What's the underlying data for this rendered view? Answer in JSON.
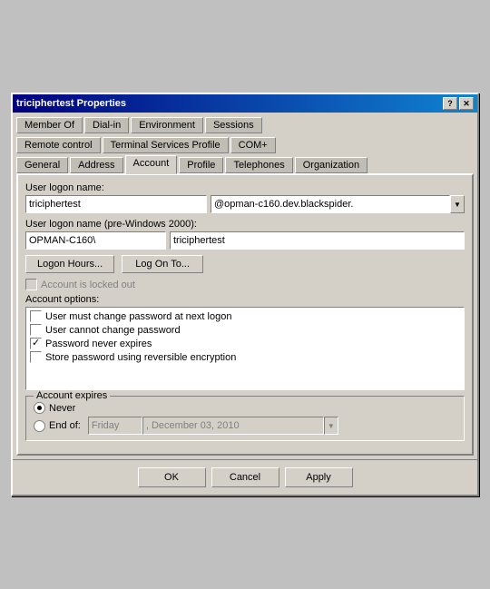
{
  "window": {
    "title": "triciphertest Properties",
    "help_btn": "?",
    "close_btn": "✕"
  },
  "tabs": {
    "row1": [
      {
        "label": "Member Of",
        "active": false
      },
      {
        "label": "Dial-in",
        "active": false
      },
      {
        "label": "Environment",
        "active": false
      },
      {
        "label": "Sessions",
        "active": false
      }
    ],
    "row2": [
      {
        "label": "Remote control",
        "active": false
      },
      {
        "label": "Terminal Services Profile",
        "active": false
      },
      {
        "label": "COM+",
        "active": false
      }
    ],
    "row3": [
      {
        "label": "General",
        "active": false
      },
      {
        "label": "Address",
        "active": false
      },
      {
        "label": "Account",
        "active": true
      },
      {
        "label": "Profile",
        "active": false
      },
      {
        "label": "Telephones",
        "active": false
      },
      {
        "label": "Organization",
        "active": false
      }
    ]
  },
  "form": {
    "logon_label": "User logon name:",
    "logon_value": "triciphertest",
    "domain_value": "@opman-c160.dev.blackspider.",
    "logon_pre2000_label": "User logon name (pre-Windows 2000):",
    "logon_pre2000_prefix": "OPMAN-C160\\",
    "logon_pre2000_value": "triciphertest",
    "logon_hours_btn": "Logon Hours...",
    "log_on_to_btn": "Log On To...",
    "locked_out_label": "Account is locked out",
    "account_options_label": "Account options:",
    "options": [
      {
        "label": "User must change password at next logon",
        "checked": false,
        "enabled": true
      },
      {
        "label": "User cannot change password",
        "checked": false,
        "enabled": true
      },
      {
        "label": "Password never expires",
        "checked": true,
        "enabled": true
      },
      {
        "label": "Store password using reversible encryption",
        "checked": false,
        "enabled": true
      }
    ],
    "account_expires_label": "Account expires",
    "never_label": "Never",
    "end_of_label": "End of:",
    "end_of_day": "Friday",
    "end_of_date": ", December 03, 2010"
  },
  "buttons": {
    "ok": "OK",
    "cancel": "Cancel",
    "apply": "Apply"
  }
}
